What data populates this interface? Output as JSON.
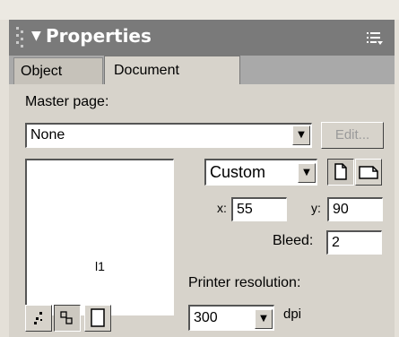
{
  "panel": {
    "title": "Properties",
    "icons": {
      "collapse": "triangle-down-icon",
      "options_menu": "panel-menu-icon",
      "grip": "grip-icon"
    }
  },
  "tabs": [
    {
      "label": "Object",
      "active": false
    },
    {
      "label": "Document",
      "active": true
    }
  ],
  "master_page": {
    "label": "Master page:",
    "value": "None",
    "edit_label": "Edit...",
    "edit_enabled": false
  },
  "preview": {
    "label": "l1"
  },
  "page_size": {
    "value": "Custom"
  },
  "orientation": {
    "selected": "portrait",
    "icons": [
      "portrait-page-icon",
      "landscape-page-icon"
    ]
  },
  "coordinates": {
    "x_label": "x:",
    "x_value": "55",
    "y_label": "y:",
    "y_value": "90"
  },
  "bleed": {
    "label": "Bleed:",
    "value": "2"
  },
  "printer_resolution": {
    "label": "Printer resolution:",
    "value": "300",
    "unit": "dpi"
  },
  "view_buttons": {
    "icons": [
      "fit-page-icon",
      "alignment-icon",
      "page-icon"
    ],
    "selected_index": 1
  },
  "colors": {
    "title_bar": "#7a7a7a",
    "panel_bg": "#d7d3cb",
    "tab_bar": "#a9a9a9"
  }
}
